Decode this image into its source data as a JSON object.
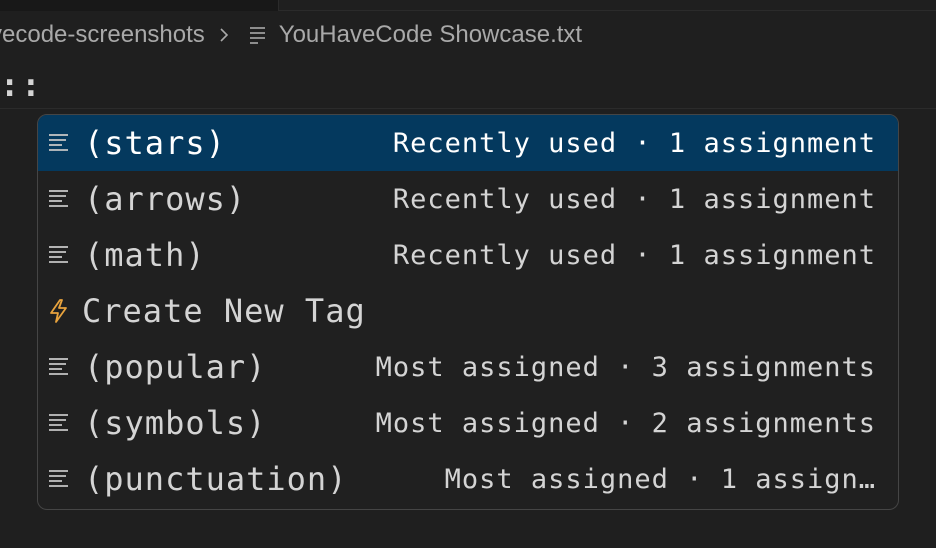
{
  "breadcrumb": {
    "folder": "vecode-screenshots",
    "file": "YouHaveCode Showcase.txt"
  },
  "editor": {
    "line_text": "::"
  },
  "suggestions": [
    {
      "label": "(stars)",
      "detail": "Recently used · 1 assignment",
      "icon": "tag-list-icon",
      "selected": true
    },
    {
      "label": "(arrows)",
      "detail": "Recently used · 1 assignment",
      "icon": "tag-list-icon",
      "selected": false
    },
    {
      "label": "(math)",
      "detail": "Recently used · 1 assignment",
      "icon": "tag-list-icon",
      "selected": false
    },
    {
      "label": "Create New Tag",
      "detail": "",
      "icon": "lightning-bolt-icon",
      "selected": false
    },
    {
      "label": "(popular)",
      "detail": "Most assigned · 3 assignments",
      "icon": "tag-list-icon",
      "selected": false
    },
    {
      "label": "(symbols)",
      "detail": "Most assigned · 2 assignments",
      "icon": "tag-list-icon",
      "selected": false
    },
    {
      "label": "(punctuation)",
      "detail": "Most assigned · 1 assign…",
      "icon": "tag-list-icon",
      "selected": false
    }
  ],
  "colors": {
    "background": "#1f1f1f",
    "selection": "#04395e",
    "bolt": "#e8a33d"
  }
}
